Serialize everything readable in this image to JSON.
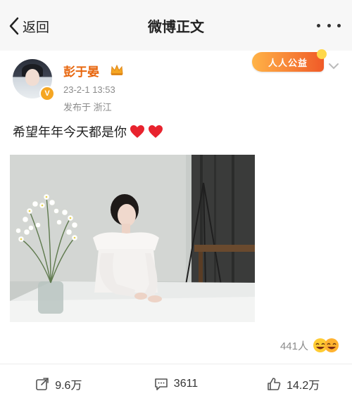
{
  "nav": {
    "back_label": "返回",
    "title": "微博正文"
  },
  "post": {
    "username": "彭于晏",
    "timestamp": "23-2-1 13:53",
    "location": "发布于 浙江",
    "badge": "人人公益",
    "text": "希望年年今天都是你",
    "likes_inline": "441人"
  },
  "actions": {
    "repost": "9.6万",
    "comments": "3611",
    "likes": "14.2万"
  },
  "colors": {
    "username": "#e8660d",
    "nav_bg": "#f7f7f7",
    "heart": "#e8232e"
  },
  "icons": {
    "back": "chevron-left-icon",
    "more": "more-dots-icon",
    "verified": "verified-v-icon",
    "crown": "crown-icon",
    "heart": "heart-icon",
    "repost": "repost-icon",
    "comment": "comment-icon",
    "like": "thumbs-up-icon"
  }
}
